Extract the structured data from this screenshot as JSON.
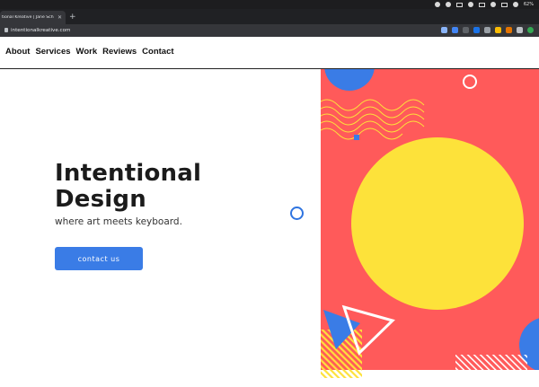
{
  "browser": {
    "tab_title": "tional Kreative | Jane Sch",
    "tab_close": "✕",
    "new_tab": "+",
    "url": "intentionalkreative.com",
    "battery": "62%"
  },
  "nav": {
    "items": [
      "About",
      "Services",
      "Work",
      "Reviews",
      "Contact"
    ]
  },
  "hero": {
    "title_line1": "Intentional",
    "title_line2": "Design",
    "subtitle": "where art meets keyboard.",
    "cta_label": "contact us"
  },
  "colors": {
    "accent_blue": "#3a7ce6",
    "coral": "#ff5a5a",
    "yellow": "#fde23a"
  }
}
